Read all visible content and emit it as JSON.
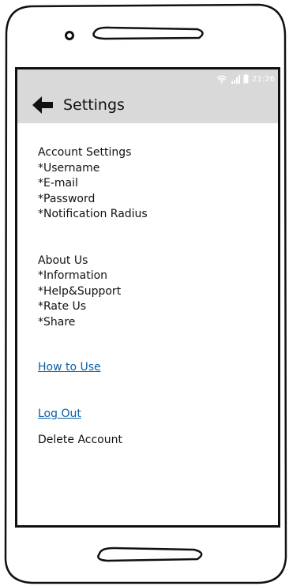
{
  "status_bar": {
    "time": "21:26",
    "wifi_icon": "wifi-icon",
    "signal_icon": "cell-signal-icon",
    "battery_icon": "battery-icon"
  },
  "app_bar": {
    "back_icon": "arrow-left-icon",
    "title": "Settings"
  },
  "account_settings": {
    "header": "Account Settings",
    "items": [
      "*Username",
      "*E-mail",
      "*Password",
      "*Notification Radius"
    ]
  },
  "about_us": {
    "header": "About Us",
    "items": [
      "*Information",
      "*Help&Support",
      "*Rate Us",
      "*Share"
    ]
  },
  "links": {
    "how_to_use": "How to Use",
    "log_out": "Log Out"
  },
  "delete_account": "Delete Account",
  "colors": {
    "bar": "#d9d9d9",
    "link": "#0a5ea8"
  }
}
